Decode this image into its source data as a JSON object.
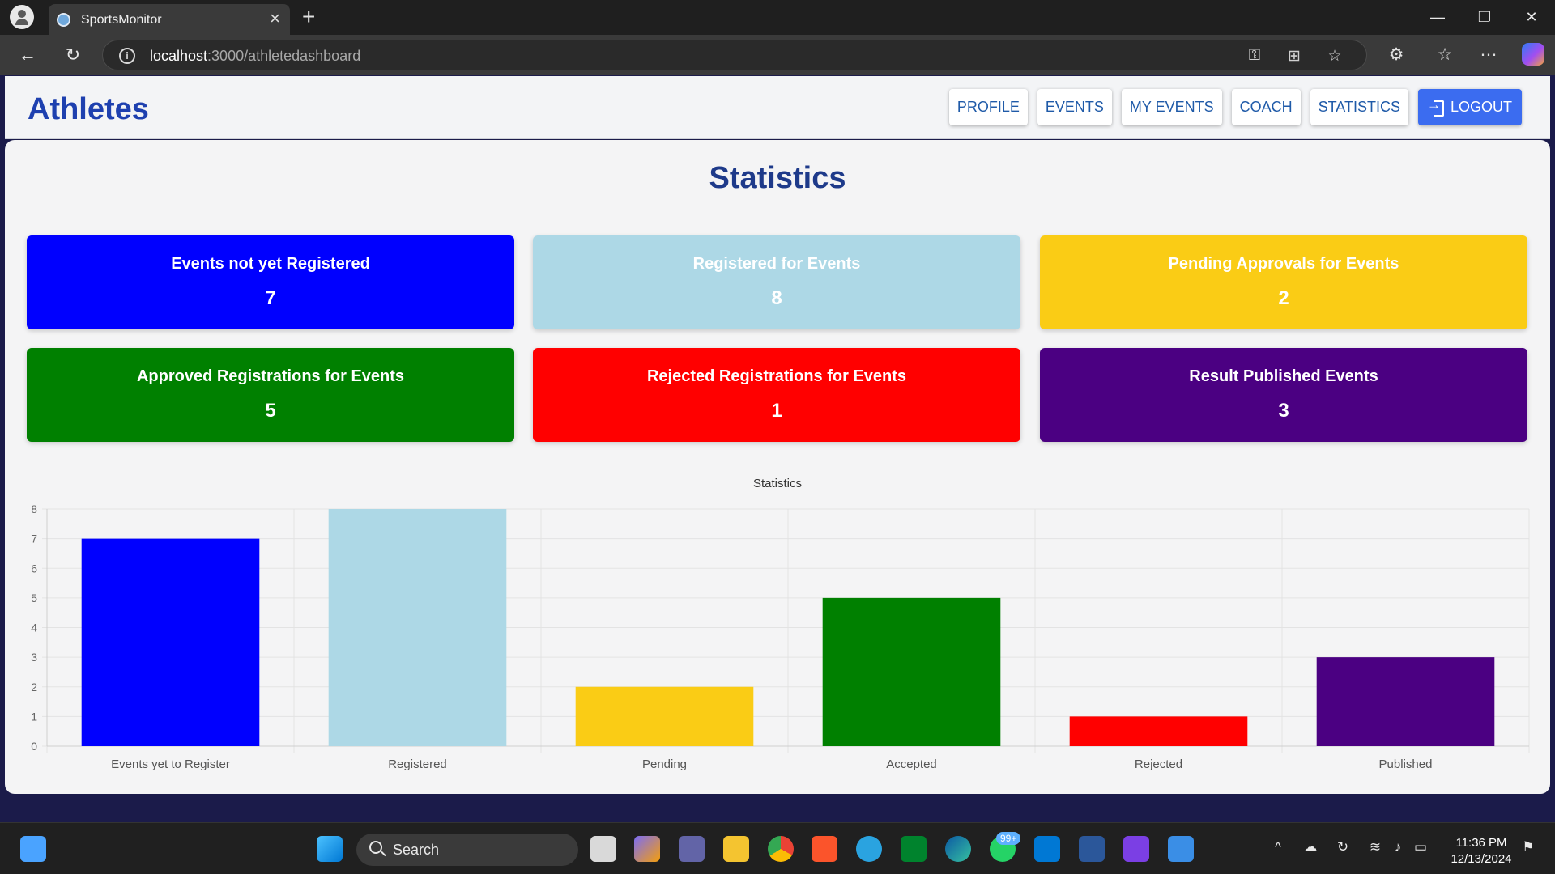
{
  "browser": {
    "tab_title": "SportsMonitor",
    "url_host": "localhost",
    "url_path": ":3000/athletedashboard"
  },
  "app": {
    "brand": "Athletes",
    "nav": [
      "PROFILE",
      "EVENTS",
      "MY EVENTS",
      "COACH",
      "STATISTICS"
    ],
    "logout": "LOGOUT"
  },
  "page": {
    "title": "Statistics"
  },
  "cards": [
    {
      "label": "Events not yet Registered",
      "value": "7",
      "color": "#0000ff",
      "text": "#ffffff"
    },
    {
      "label": "Registered for Events",
      "value": "8",
      "color": "#add8e6",
      "text": "#ffffff"
    },
    {
      "label": "Pending Approvals for Events",
      "value": "2",
      "color": "#facc15",
      "text": "#ffffff"
    },
    {
      "label": "Approved Registrations for Events",
      "value": "5",
      "color": "#008000",
      "text": "#ffffff"
    },
    {
      "label": "Rejected Registrations for Events",
      "value": "1",
      "color": "#ff0000",
      "text": "#ffffff"
    },
    {
      "label": "Result Published Events",
      "value": "3",
      "color": "#4b0082",
      "text": "#ffffff"
    }
  ],
  "chart_data": {
    "type": "bar",
    "title": "Statistics",
    "categories": [
      "Events yet to Register",
      "Registered",
      "Pending",
      "Accepted",
      "Rejected",
      "Published"
    ],
    "values": [
      7,
      8,
      2,
      5,
      1,
      3
    ],
    "colors": [
      "#0000ff",
      "#add8e6",
      "#facc15",
      "#008000",
      "#ff0000",
      "#4b0082"
    ],
    "ylim": [
      0,
      8
    ],
    "yticks": [
      0,
      1,
      2,
      3,
      4,
      5,
      6,
      7,
      8
    ],
    "grid": true,
    "xlabel": "",
    "ylabel": ""
  },
  "taskbar": {
    "search_label": "Search",
    "notification_badge": "99+",
    "time": "11:36 PM",
    "date": "12/13/2024"
  }
}
